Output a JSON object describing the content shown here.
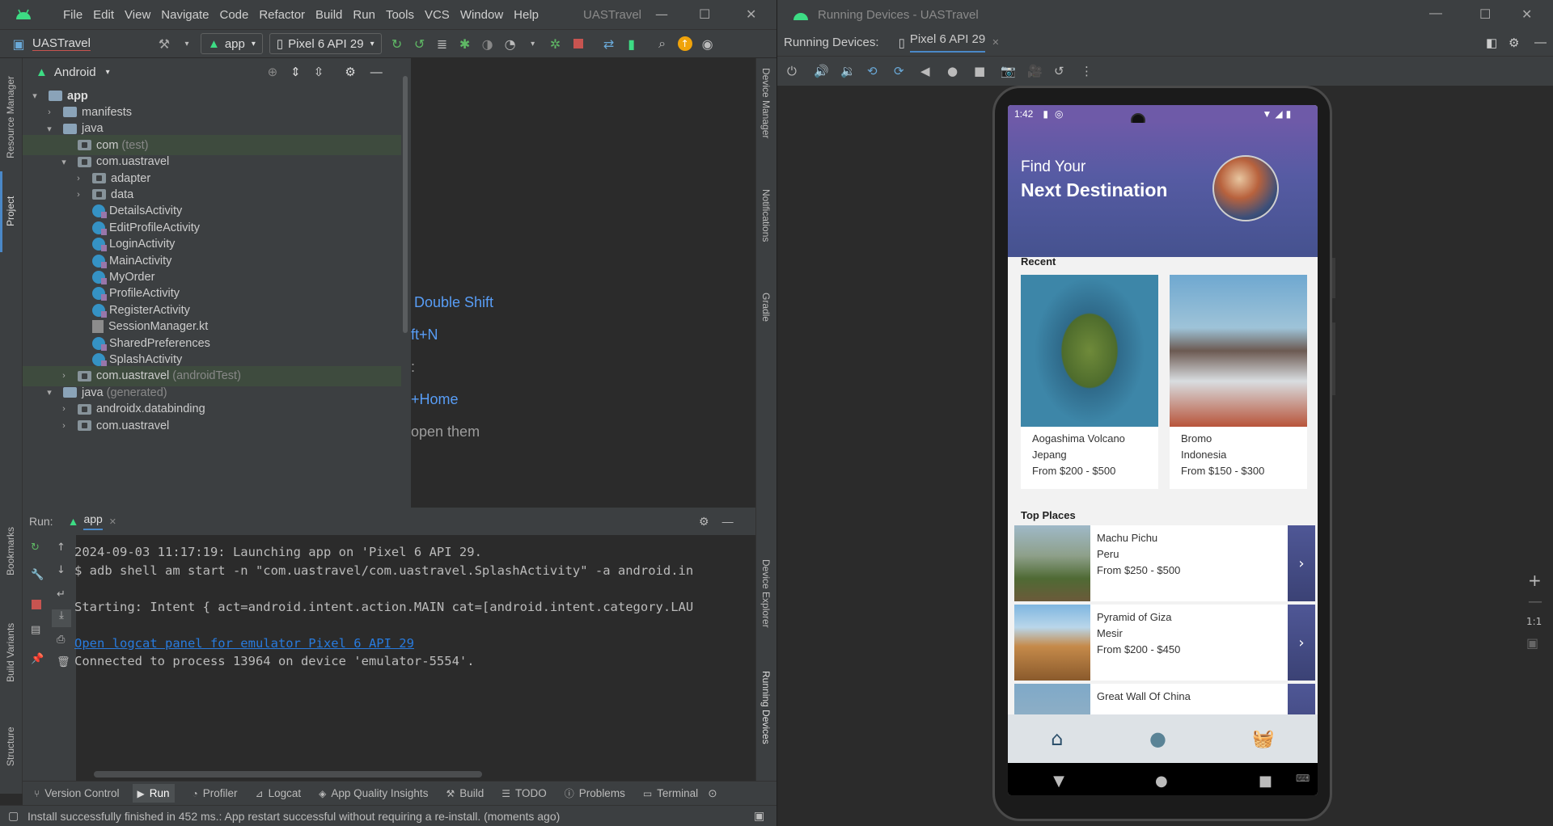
{
  "ide": {
    "menu": [
      "File",
      "Edit",
      "View",
      "Navigate",
      "Code",
      "Refactor",
      "Build",
      "Run",
      "Tools",
      "VCS",
      "Window",
      "Help"
    ],
    "window_title": "UASTravel",
    "project_name": "UASTravel",
    "run_config": "app",
    "device_selector": "Pixel 6 API 29",
    "project_view": "Android",
    "left_strip": [
      "Resource Manager",
      "Project",
      "Bookmarks",
      "Build Variants",
      "Structure"
    ],
    "right_strip": [
      "Device Manager",
      "Notifications",
      "Gradle",
      "Device Explorer",
      "Running Devices"
    ],
    "tree": [
      {
        "label": "app",
        "suffix": "",
        "depth": 0,
        "icon": "module-icon",
        "chev": "▾",
        "bold": true
      },
      {
        "label": "manifests",
        "suffix": "",
        "depth": 1,
        "icon": "folder-icon",
        "chev": "›"
      },
      {
        "label": "java",
        "suffix": "",
        "depth": 1,
        "icon": "folder-icon",
        "chev": "▾"
      },
      {
        "label": "com",
        "suffix": " (test)",
        "depth": 2,
        "icon": "package-icon",
        "chev": "",
        "selected": true
      },
      {
        "label": "com.uastravel",
        "suffix": "",
        "depth": 2,
        "icon": "package-icon",
        "chev": "▾"
      },
      {
        "label": "adapter",
        "suffix": "",
        "depth": 3,
        "icon": "package-icon",
        "chev": "›"
      },
      {
        "label": "data",
        "suffix": "",
        "depth": 3,
        "icon": "package-icon",
        "chev": "›"
      },
      {
        "label": "DetailsActivity",
        "suffix": "",
        "depth": 3,
        "icon": "class-icon",
        "chev": ""
      },
      {
        "label": "EditProfileActivity",
        "suffix": "",
        "depth": 3,
        "icon": "class-icon",
        "chev": ""
      },
      {
        "label": "LoginActivity",
        "suffix": "",
        "depth": 3,
        "icon": "class-icon",
        "chev": ""
      },
      {
        "label": "MainActivity",
        "suffix": "",
        "depth": 3,
        "icon": "class-icon",
        "chev": ""
      },
      {
        "label": "MyOrder",
        "suffix": "",
        "depth": 3,
        "icon": "class-icon",
        "chev": ""
      },
      {
        "label": "ProfileActivity",
        "suffix": "",
        "depth": 3,
        "icon": "class-icon",
        "chev": ""
      },
      {
        "label": "RegisterActivity",
        "suffix": "",
        "depth": 3,
        "icon": "class-icon",
        "chev": ""
      },
      {
        "label": "SessionManager.kt",
        "suffix": "",
        "depth": 3,
        "icon": "kotlin-file-icon",
        "chev": ""
      },
      {
        "label": "SharedPreferences",
        "suffix": "",
        "depth": 3,
        "icon": "class-icon",
        "chev": ""
      },
      {
        "label": "SplashActivity",
        "suffix": "",
        "depth": 3,
        "icon": "class-icon",
        "chev": ""
      },
      {
        "label": "com.uastravel",
        "suffix": " (androidTest)",
        "depth": 2,
        "icon": "package-icon",
        "chev": "›",
        "selected": true
      },
      {
        "label": "java",
        "suffix": " (generated)",
        "depth": 1,
        "icon": "folder-icon",
        "chev": "▾"
      },
      {
        "label": "androidx.databinding",
        "suffix": "",
        "depth": 2,
        "icon": "package-icon",
        "chev": "›"
      },
      {
        "label": "com.uastravel",
        "suffix": "",
        "depth": 2,
        "icon": "package-icon",
        "chev": "›"
      }
    ],
    "editor_hints": [
      {
        "text": "Double Shift",
        "color": "link"
      },
      {
        "text": "ft+N",
        "color": "link"
      },
      {
        "text": ":",
        "color": "gray"
      },
      {
        "text": "+Home",
        "color": "link"
      },
      {
        "text": "open them",
        "color": "gray"
      }
    ],
    "run": {
      "label": "Run:",
      "tab": "app",
      "lines": [
        {
          "text": "2024-09-03 11:17:19: Launching app on 'Pixel 6 API 29.",
          "link": false
        },
        {
          "text": "$ adb shell am start -n \"com.uastravel/com.uastravel.SplashActivity\" -a android.in",
          "link": false
        },
        {
          "text": "",
          "link": false
        },
        {
          "text": "Starting: Intent { act=android.intent.action.MAIN cat=[android.intent.category.LAU",
          "link": false
        },
        {
          "text": "",
          "link": false
        },
        {
          "text": "Open logcat panel for emulator Pixel 6 API 29",
          "link": true
        },
        {
          "text": "Connected to process 13964 on device 'emulator-5554'.",
          "link": false
        }
      ]
    },
    "bottom_tabs": [
      "Version Control",
      "Run",
      "Profiler",
      "Logcat",
      "App Quality Insights",
      "Build",
      "TODO",
      "Problems",
      "Terminal"
    ],
    "status": "Install successfully finished in 452 ms.: App restart successful without requiring a re-install. (moments ago)"
  },
  "running_devices": {
    "window_title": "Running Devices - UASTravel",
    "label": "Running Devices:",
    "tab": "Pixel 6 API 29",
    "zoom_label": "1:1"
  },
  "app": {
    "time": "1:42",
    "hero_line1": "Find Your",
    "hero_line2": "Next Destination",
    "recent_title": "Recent",
    "recent": [
      {
        "name": "Aogashima Volcano",
        "country": "Jepang",
        "price": "From $200 - $500"
      },
      {
        "name": "Bromo",
        "country": "Indonesia",
        "price": "From $150 - $300"
      }
    ],
    "top_title": "Top Places",
    "top": [
      {
        "name": "Machu Pichu",
        "country": "Peru",
        "price": "From $250 - $500"
      },
      {
        "name": "Pyramid of Giza",
        "country": "Mesir",
        "price": "From $200 - $450"
      },
      {
        "name": "Great Wall Of China",
        "country": "",
        "price": ""
      }
    ]
  },
  "colors": {
    "accent": "#589df6",
    "android_green": "#3ddc84",
    "purple": "#6e5aa8",
    "navy": "#3b4275"
  }
}
